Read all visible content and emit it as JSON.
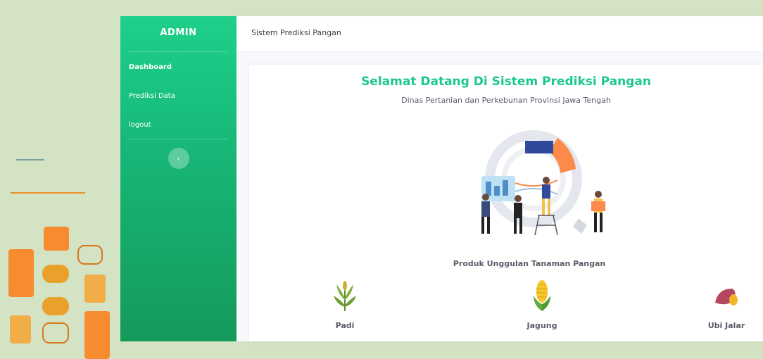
{
  "sidebar": {
    "brand": "ADMIN",
    "items": [
      {
        "label": "Dashboard"
      },
      {
        "label": "Prediksi Data"
      },
      {
        "label": "logout"
      }
    ],
    "toggle_icon": "chevron-left-icon"
  },
  "topbar": {
    "title": "Sistem Prediksi Pangan"
  },
  "main": {
    "welcome": "Selamat Datang Di Sistem Prediksi Pangan",
    "subtitle": "Dinas Pertanian dan Perkebunan Provinsi Jawa Tengah",
    "products_title": "Produk Unggulan Tanaman Pangan",
    "products": [
      {
        "name": "Padi",
        "icon": "rice-icon"
      },
      {
        "name": "Jagung",
        "icon": "corn-icon"
      },
      {
        "name": "Ubi Jalar",
        "icon": "sweet-potato-icon"
      }
    ]
  },
  "colors": {
    "accent": "#1cc88a",
    "sidebar_top": "#1ed08a",
    "sidebar_bottom": "#15995a",
    "background": "#d3e3c3"
  }
}
